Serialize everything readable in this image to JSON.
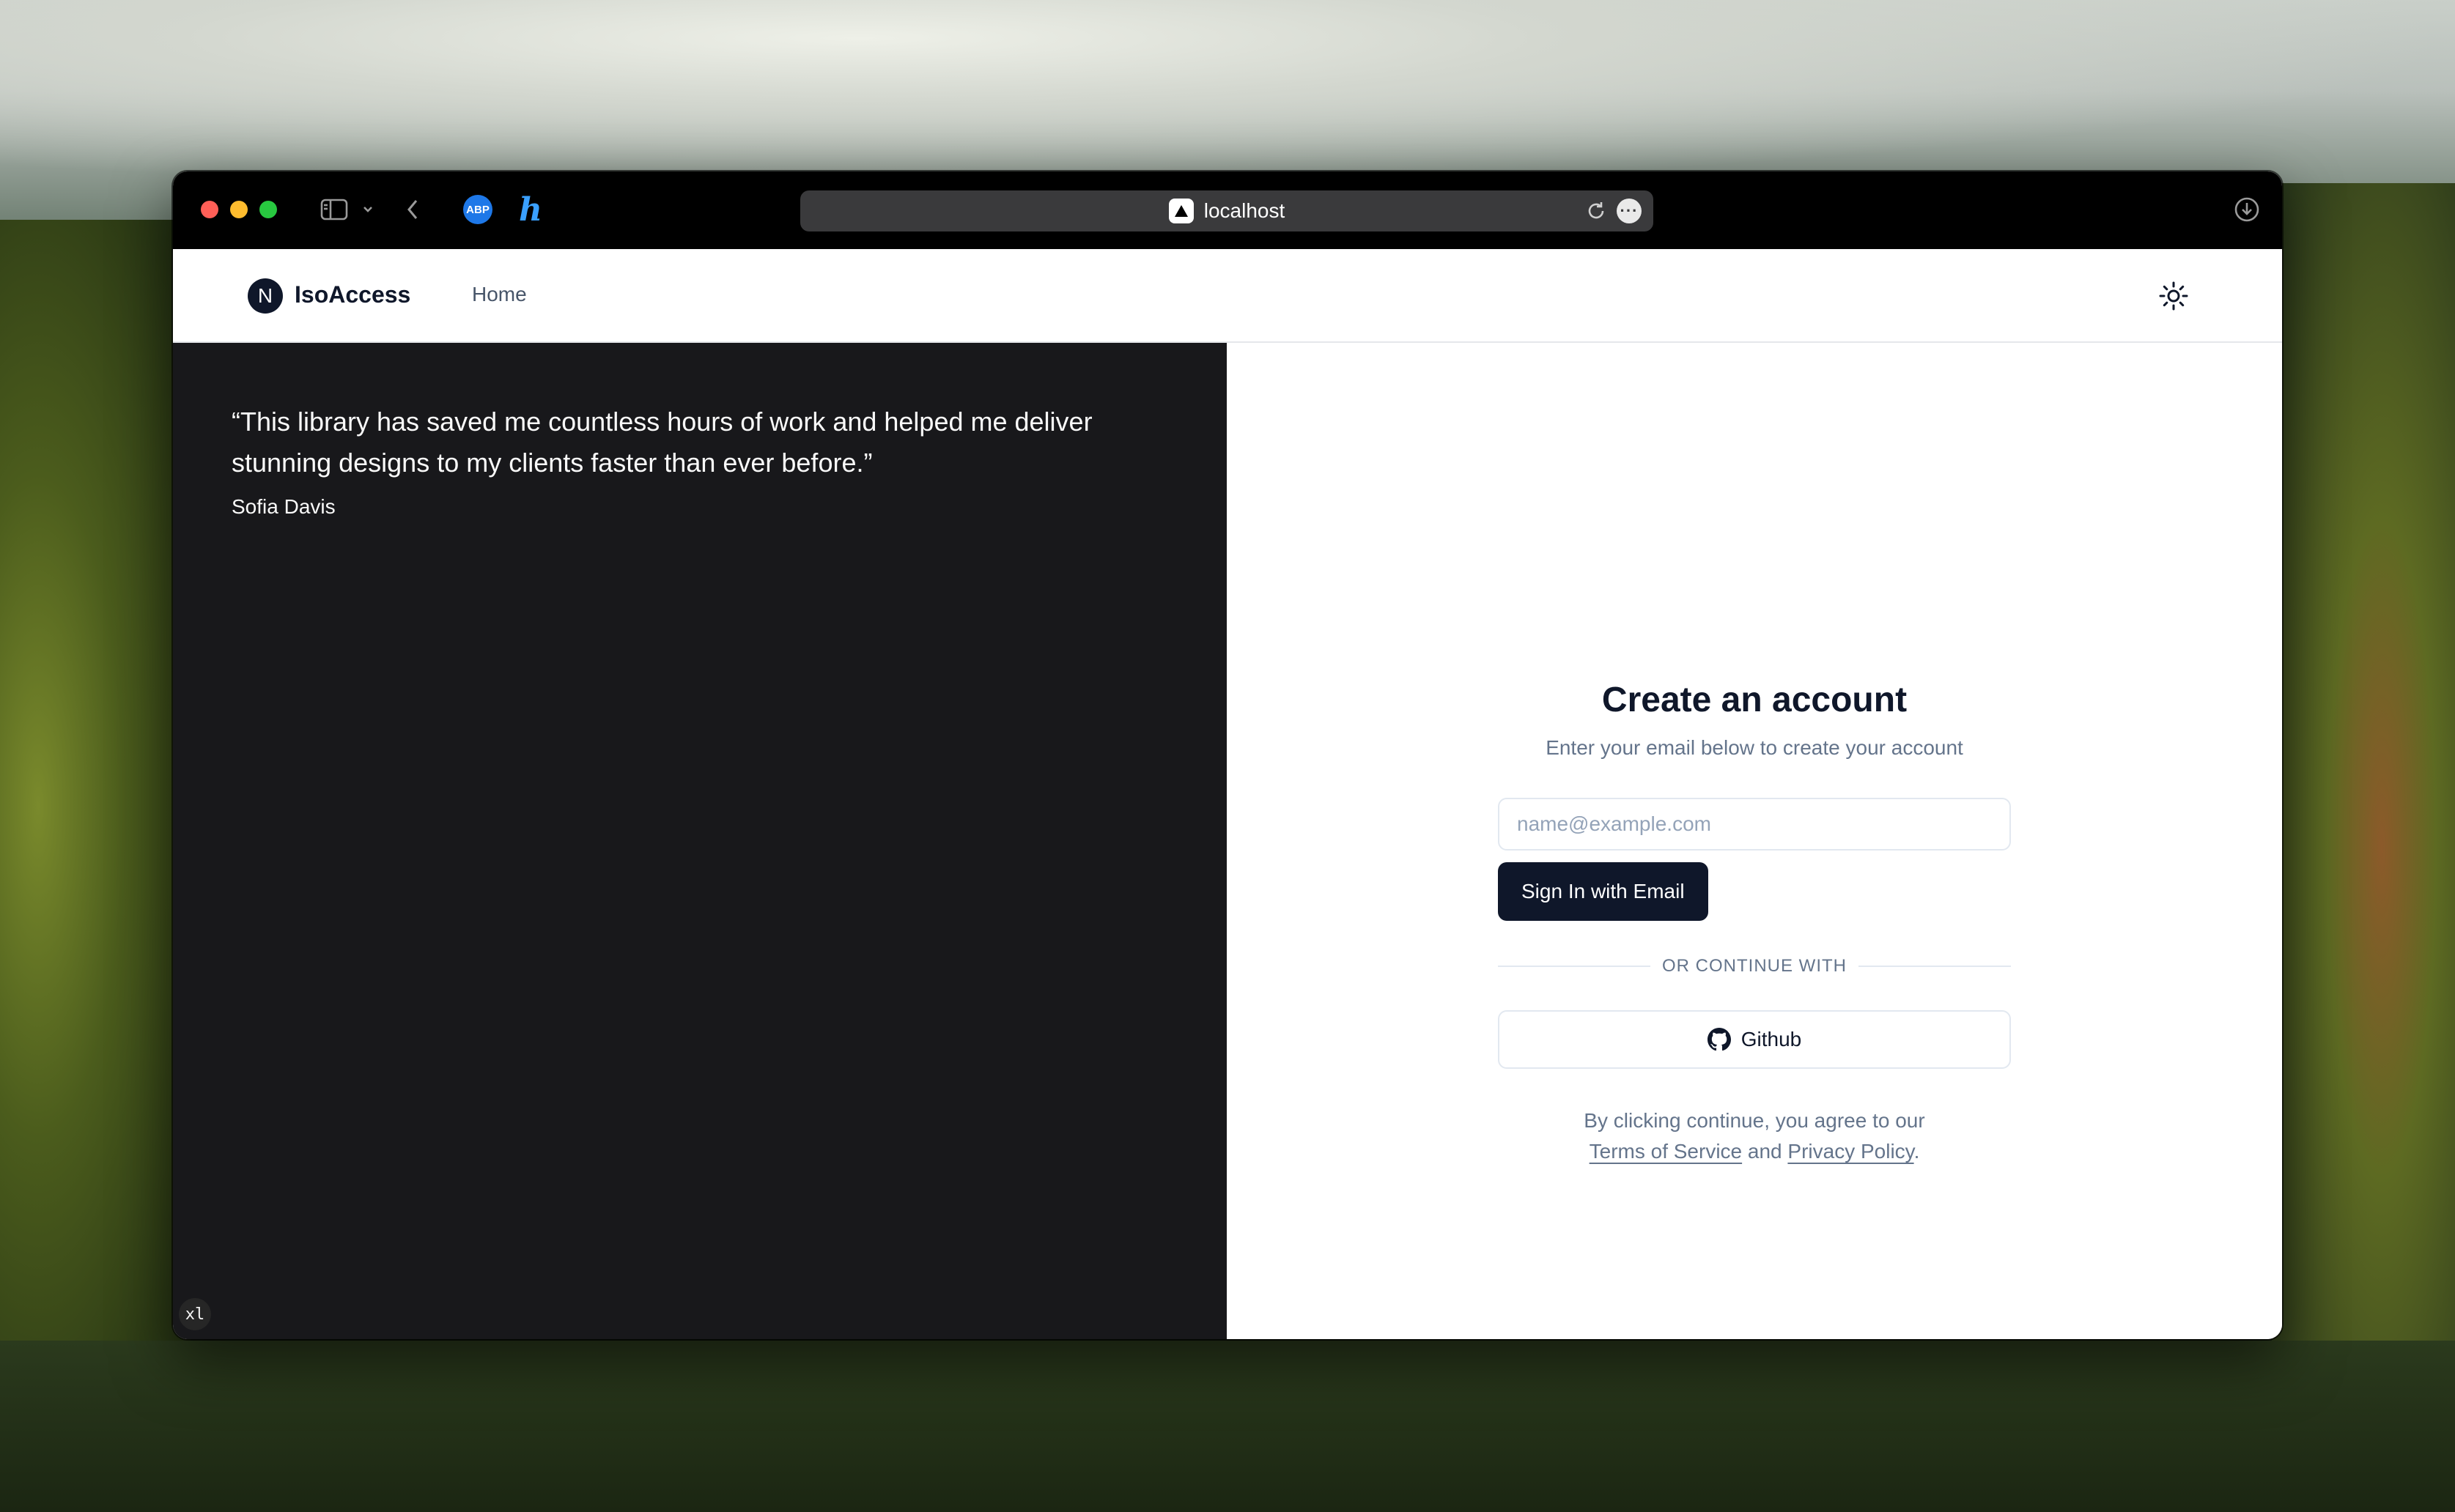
{
  "browser": {
    "url": "localhost",
    "icons": [
      "sidebar-icon",
      "chevron-down-icon",
      "back-icon",
      "reload-icon",
      "more-icon",
      "download-icon",
      "share-icon",
      "plus-icon",
      "tabs-icon"
    ],
    "extension_abp_label": "ABP",
    "extension_honey_label": "h"
  },
  "nav": {
    "logo_letter": "N",
    "brand": "IsoAccess",
    "home": "Home"
  },
  "testimonial": {
    "quote": "“This library has saved me countless hours of work and helped me deliver stunning designs to my clients faster than ever before.”",
    "author": "Sofia Davis"
  },
  "form": {
    "title": "Create an account",
    "subtitle": "Enter your email below to create your account",
    "email_placeholder": "name@example.com",
    "email_value": "",
    "submit_label": "Sign In with Email",
    "divider": "OR CONTINUE WITH",
    "github_label": "Github",
    "terms_prefix": "By clicking continue, you agree to our",
    "terms_link": "Terms of Service",
    "terms_and": "and",
    "privacy_link": "Privacy Policy",
    "terms_suffix": "."
  },
  "debug_badge": "xl",
  "colors": {
    "primary": "#0f172a",
    "muted": "#64748b",
    "left_panel": "#18181b",
    "border": "#e2e8f0"
  }
}
